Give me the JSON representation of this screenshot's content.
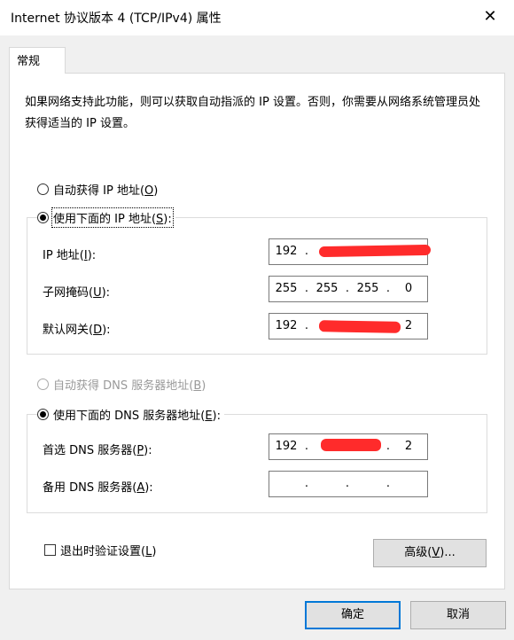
{
  "window": {
    "title": "Internet 协议版本 4 (TCP/IPv4) 属性",
    "close_glyph": "✕"
  },
  "tab": {
    "label": "常规"
  },
  "description": "如果网络支持此功能，则可以获取自动指派的 IP 设置。否则，你需要从网络系统管理员处获得适当的 IP 设置。",
  "ip_section": {
    "auto_radio": {
      "label": "自动获得 IP 地址(",
      "key": "O",
      "suffix": ")",
      "selected": false
    },
    "manual_radio": {
      "label": "使用下面的 IP 地址(",
      "key": "S",
      "suffix": "):",
      "selected": true
    },
    "ip_address": {
      "label": "IP 地址(",
      "key": "I",
      "suffix": "):",
      "octets": [
        "192",
        "",
        "",
        ""
      ]
    },
    "subnet_mask": {
      "label": "子网掩码(",
      "key": "U",
      "suffix": "):",
      "octets": [
        "255",
        "255",
        "255",
        "0"
      ]
    },
    "gateway": {
      "label": "默认网关(",
      "key": "D",
      "suffix": "):",
      "octets": [
        "192",
        "",
        "",
        "2"
      ]
    }
  },
  "dns_section": {
    "auto_radio": {
      "label": "自动获得 DNS 服务器地址(",
      "key": "B",
      "suffix": ")",
      "selected": false,
      "disabled": true
    },
    "manual_radio": {
      "label": "使用下面的 DNS 服务器地址(",
      "key": "E",
      "suffix": "):",
      "selected": true
    },
    "preferred": {
      "label": "首选 DNS 服务器(",
      "key": "P",
      "suffix": "):",
      "octets": [
        "192",
        "",
        "",
        "2"
      ]
    },
    "alternate": {
      "label": "备用 DNS 服务器(",
      "key": "A",
      "suffix": "):",
      "octets": [
        "",
        "",
        "",
        ""
      ]
    }
  },
  "validate_checkbox": {
    "label": "退出时验证设置(",
    "key": "L",
    "suffix": ")",
    "checked": false
  },
  "buttons": {
    "advanced": {
      "label": "高级(",
      "key": "V",
      "suffix": ")..."
    },
    "ok": "确定",
    "cancel": "取消"
  },
  "colors": {
    "redaction": "#ff2b2b",
    "focus_border": "#0078d7",
    "dialog_bg": "#f0f0f0"
  }
}
